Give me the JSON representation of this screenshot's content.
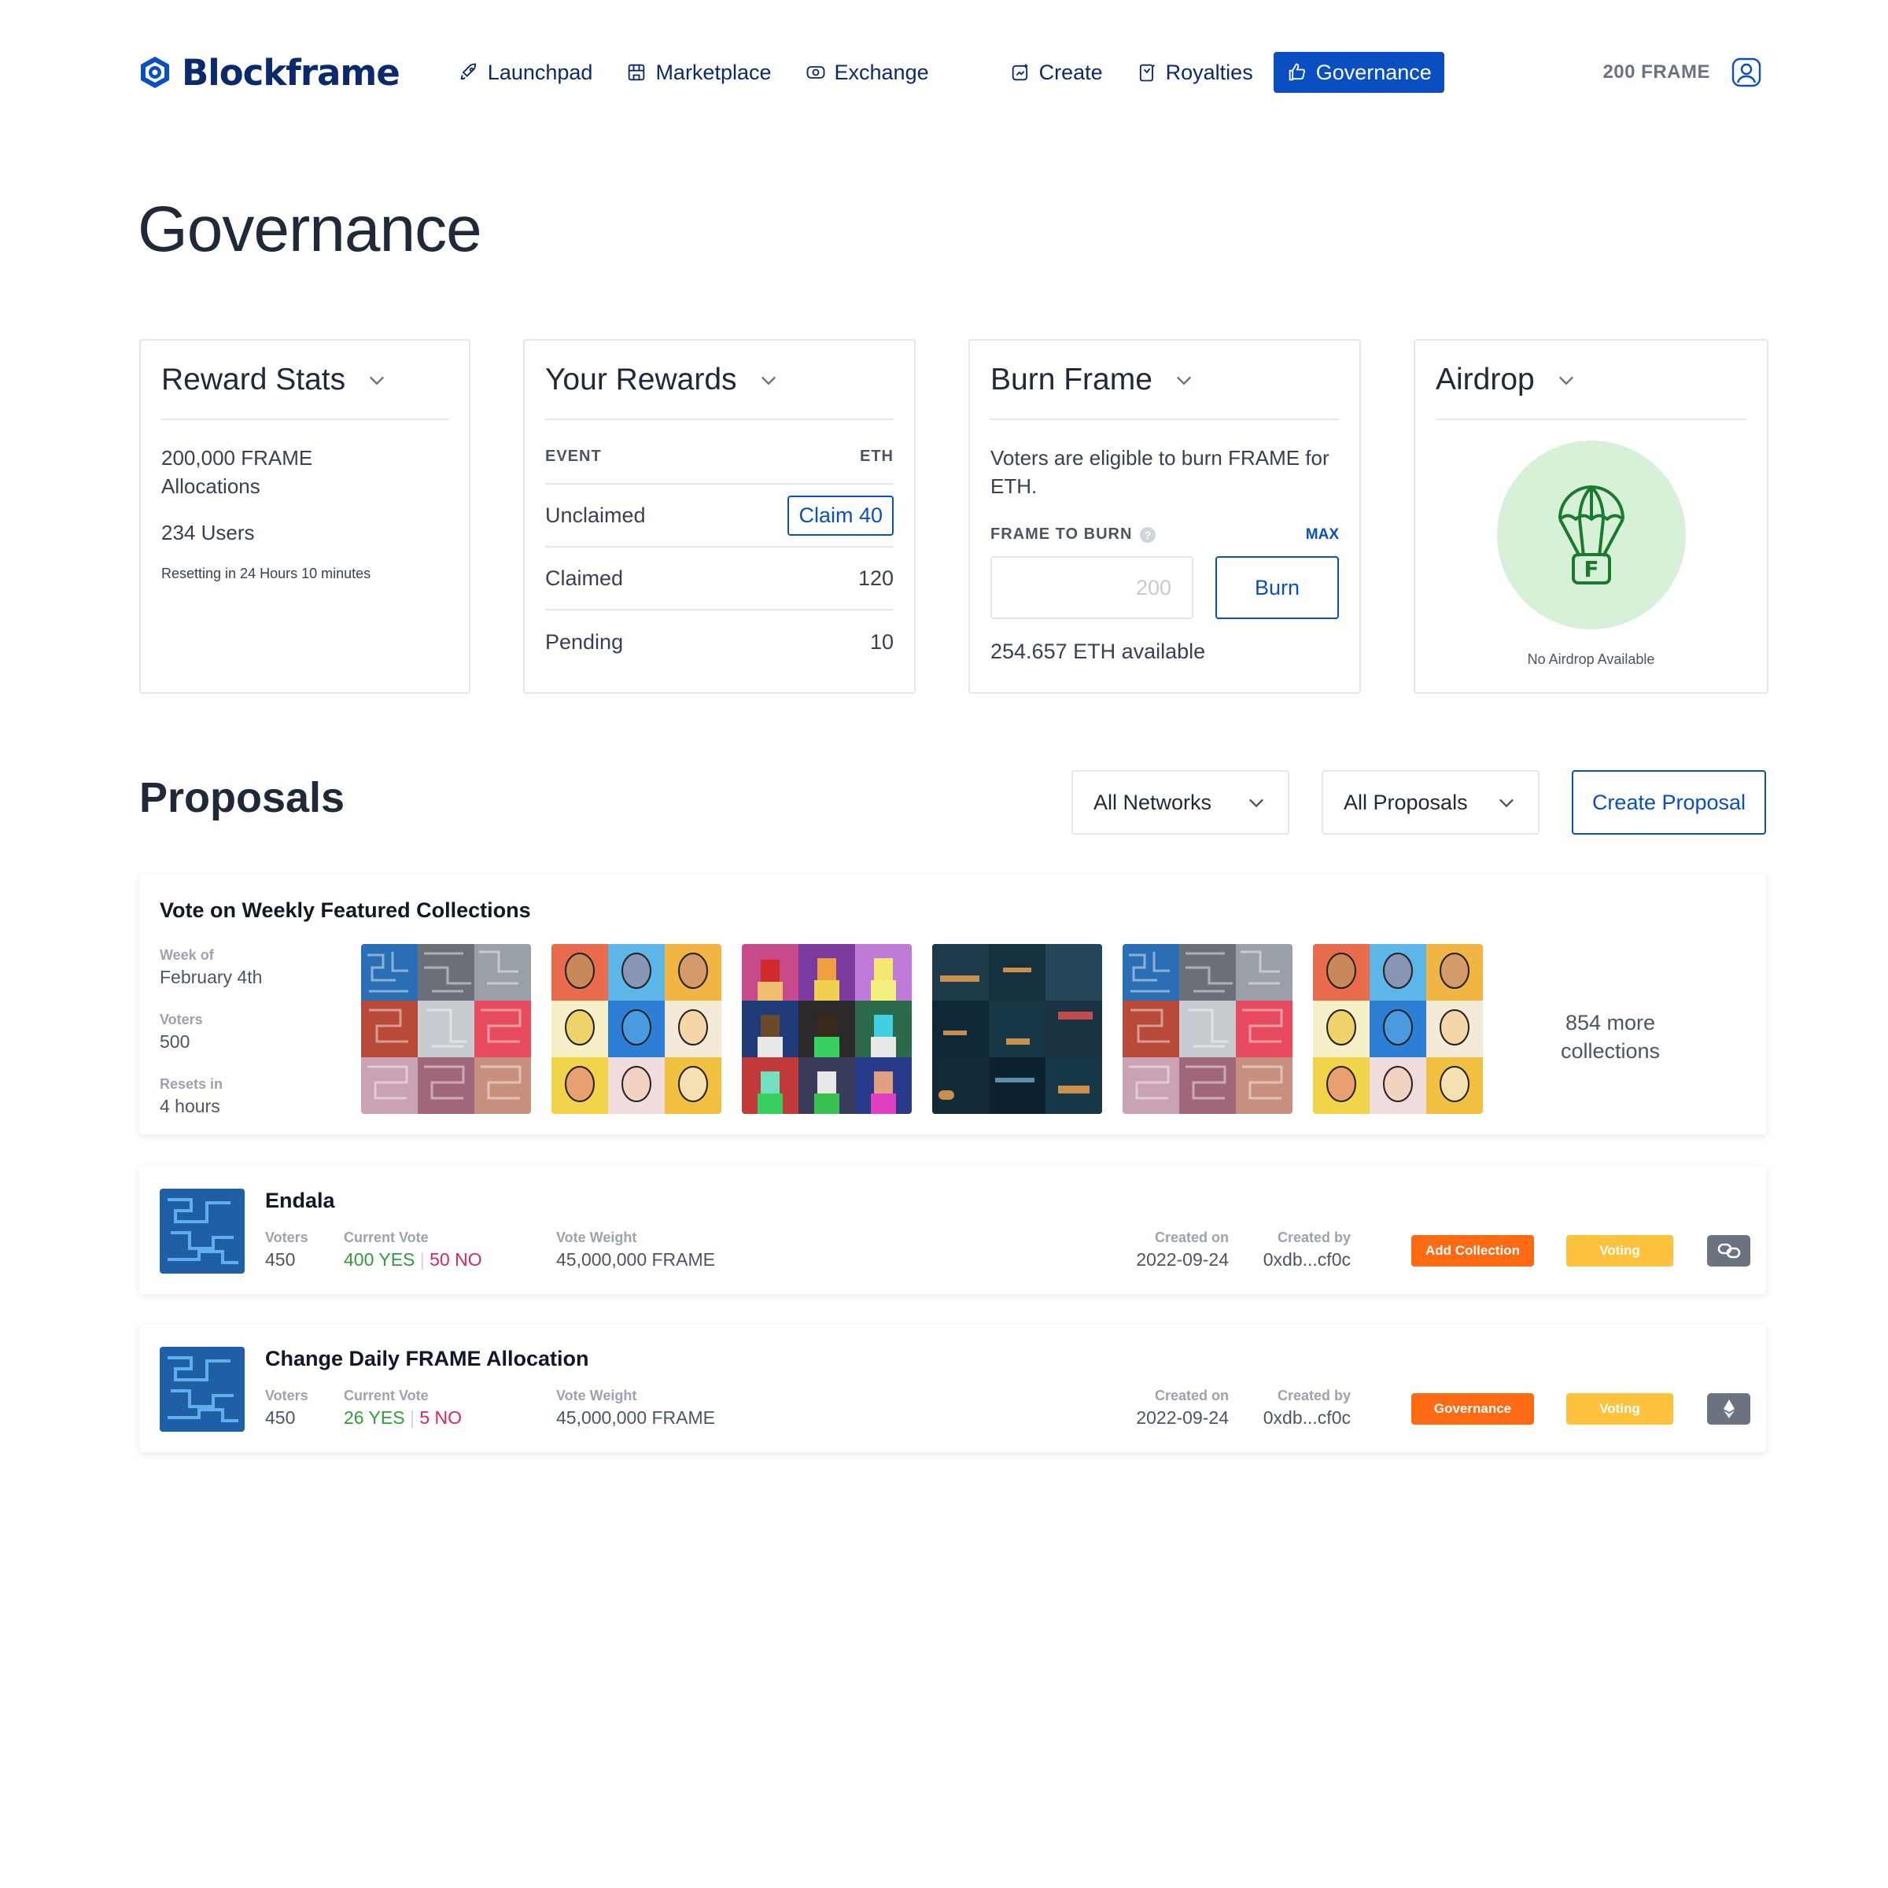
{
  "brand": {
    "name": "Blockframe"
  },
  "nav": {
    "items": [
      {
        "label": "Launchpad",
        "icon": "rocket-icon"
      },
      {
        "label": "Marketplace",
        "icon": "storefront-icon"
      },
      {
        "label": "Exchange",
        "icon": "exchange-icon"
      },
      {
        "label": "Create",
        "icon": "create-icon"
      },
      {
        "label": "Royalties",
        "icon": "royalties-icon"
      },
      {
        "label": "Governance",
        "icon": "thumbs-up-icon",
        "active": true
      }
    ],
    "balance": "200 FRAME"
  },
  "page": {
    "title": "Governance"
  },
  "reward_stats": {
    "title": "Reward Stats",
    "allocations": "200,000 FRAME Allocations",
    "users": "234 Users",
    "reset": "Resetting in 24 Hours 10 minutes"
  },
  "your_rewards": {
    "title": "Your Rewards",
    "col_event": "EVENT",
    "col_eth": "ETH",
    "unclaimed_label": "Unclaimed",
    "claim_button": "Claim 40",
    "claimed_label": "Claimed",
    "claimed_value": "120",
    "pending_label": "Pending",
    "pending_value": "10"
  },
  "burn_frame": {
    "title": "Burn Frame",
    "description": "Voters are eligible to burn FRAME for ETH.",
    "label": "FRAME TO BURN",
    "help": "?",
    "max": "MAX",
    "placeholder": "200",
    "button": "Burn",
    "available": "254.657 ETH available"
  },
  "airdrop": {
    "title": "Airdrop",
    "caption": "No Airdrop Available",
    "icon": "parachute-icon",
    "letter": "F"
  },
  "proposals": {
    "title": "Proposals",
    "filter_networks": "All Networks",
    "filter_proposals": "All Proposals",
    "create_button": "Create Proposal"
  },
  "weekly": {
    "title": "Vote on Weekly Featured Collections",
    "week_label": "Week of",
    "week_value": "February 4th",
    "voters_label": "Voters",
    "voters_value": "500",
    "resets_label": "Resets in",
    "resets_value": "4 hours",
    "more": "854 more collections"
  },
  "rows": [
    {
      "name": "Endala",
      "voters_label": "Voters",
      "voters": "450",
      "vote_label": "Current Vote",
      "yes": "400 YES",
      "sep": "|",
      "no": "50 NO",
      "weight_label": "Vote Weight",
      "weight": "45,000,000 FRAME",
      "created_on_label": "Created on",
      "created_on": "2022-09-24",
      "created_by_label": "Created by",
      "created_by": "0xdb...cf0c",
      "type": "Add Collection",
      "status": "Voting",
      "chain_icon": "link-icon"
    },
    {
      "name": "Change Daily FRAME Allocation",
      "voters_label": "Voters",
      "voters": "450",
      "vote_label": "Current Vote",
      "yes": "26 YES",
      "sep": "|",
      "no": "5 NO",
      "weight_label": "Vote Weight",
      "weight": "45,000,000 FRAME",
      "created_on_label": "Created on",
      "created_on": "2022-09-24",
      "created_by_label": "Created by",
      "created_by": "0xdb...cf0c",
      "type": "Governance",
      "status": "Voting",
      "chain_icon": "ethereum-icon"
    }
  ],
  "colors": {
    "brand_navy": "#0b2a6b",
    "accent_blue": "#0a4fc2",
    "yes_green": "#2f9e3a",
    "no_red": "#e0245e",
    "badge_orange": "#ff6a13",
    "badge_yellow": "#ffc23d"
  }
}
